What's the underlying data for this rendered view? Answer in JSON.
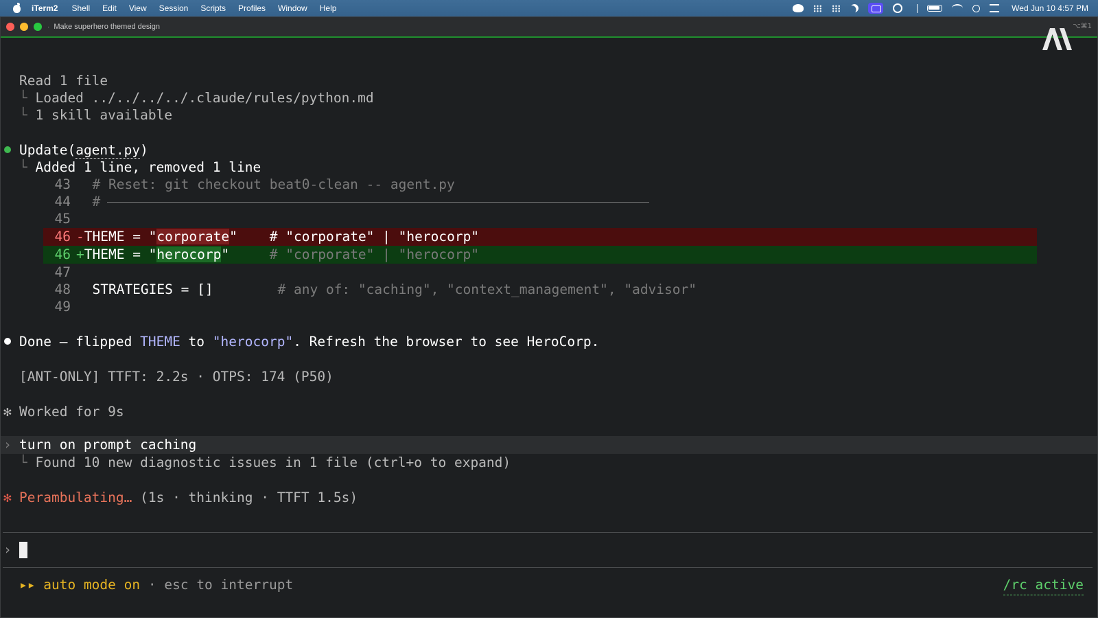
{
  "menubar": {
    "app_name": "iTerm2",
    "menus": [
      "Shell",
      "Edit",
      "View",
      "Session",
      "Scripts",
      "Profiles",
      "Window",
      "Help"
    ],
    "clock": "Wed Jun 10  4:57 PM"
  },
  "window": {
    "title": "Make superhero themed design",
    "shortcut": "⌥⌘1"
  },
  "transcript": {
    "read_header": "Read 1 file",
    "read_items": [
      "Loaded ../../../../.claude/rules/python.md",
      "1 skill available"
    ],
    "update_tool": "Update",
    "update_file": "agent.py",
    "update_summary": "Added 1 line, removed 1 line",
    "diff": [
      {
        "num": "43",
        "kind": "context",
        "text": "# Reset: git checkout beat0-clean -- agent.py"
      },
      {
        "num": "44",
        "kind": "context",
        "text": "#"
      },
      {
        "num": "45",
        "kind": "context",
        "text": ""
      },
      {
        "num": "46",
        "kind": "del",
        "prefix": "THEME = \"",
        "highlight": "corporate",
        "suffix": "\"",
        "comment": "    # \"corporate\" | \"herocorp\""
      },
      {
        "num": "46",
        "kind": "add",
        "prefix": "THEME = \"",
        "highlight": "herocorp",
        "suffix": "\"",
        "comment": "     # \"corporate\" | \"herocorp\""
      },
      {
        "num": "47",
        "kind": "context",
        "text": ""
      },
      {
        "num": "48",
        "kind": "context",
        "code": "STRATEGIES = []",
        "comment": "# any of: \"caching\", \"context_management\", \"advisor\""
      },
      {
        "num": "49",
        "kind": "context",
        "text": ""
      }
    ],
    "done_prefix": "Done — flipped ",
    "done_theme": "THEME",
    "done_mid": " to ",
    "done_value": "\"herocorp\"",
    "done_suffix": ". Refresh the browser to see HeroCorp.",
    "metrics": "[ANT-ONLY] TTFT: 2.2s · OTPS: 174 (P50)",
    "worked": "Worked for 9s",
    "user_prompt": "turn on prompt caching",
    "diagnostics": "Found 10 new diagnostic issues in 1 file (ctrl+o to expand)",
    "status_word": "Perambulating…",
    "status_detail": " (1s · thinking · TTFT 1.5s)"
  },
  "footer": {
    "arrows": "▸▸",
    "mode": "auto mode on",
    "sep": " · ",
    "hint": "esc to interrupt",
    "rc": "/rc active"
  }
}
